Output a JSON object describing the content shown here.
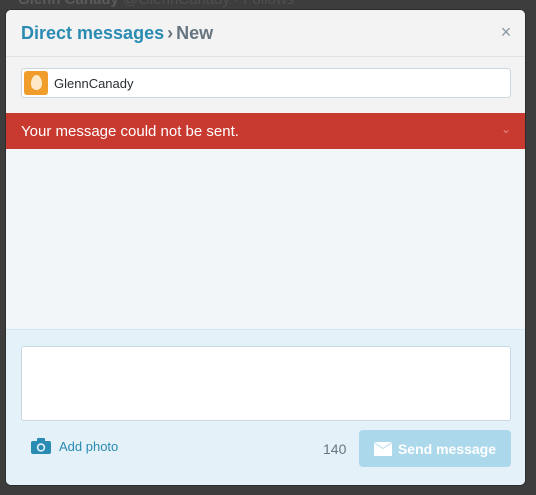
{
  "background": {
    "text_main": "Glenn Canady",
    "text_muted": "@GlennCanady · Follows"
  },
  "modal": {
    "breadcrumb_link": "Direct messages",
    "breadcrumb_separator": "›",
    "breadcrumb_current": "New",
    "close_glyph": "×",
    "close_icon": "close-icon"
  },
  "recipient": {
    "name": "GlennCanady",
    "avatar": "default-egg-avatar"
  },
  "error": {
    "text": "Your message could not be sent.",
    "chevron_glyph": "⌄"
  },
  "composer": {
    "message_value": "",
    "add_photo_label": "Add photo",
    "camera_icon": "camera-icon",
    "char_count": "140",
    "send_label": "Send message",
    "send_icon": "envelope-icon"
  },
  "colors": {
    "accent": "#2a8bb3",
    "error": "#c8392f",
    "send_disabled": "#acd8ec",
    "composer_bg": "#e4f1f8"
  }
}
